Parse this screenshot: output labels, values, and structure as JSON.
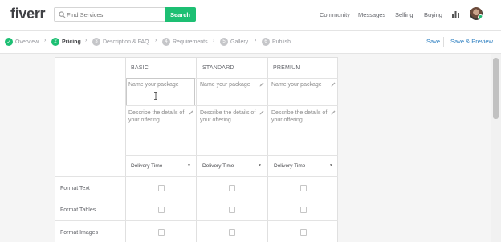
{
  "header": {
    "logo": "fiverr",
    "search_placeholder": "Find Services",
    "search_button": "Search",
    "nav": [
      "Community",
      "Messages",
      "Selling",
      "Buying"
    ]
  },
  "steps": [
    {
      "num": "✓",
      "label": "Overview",
      "state": "done"
    },
    {
      "num": "2",
      "label": "Pricing",
      "state": "active"
    },
    {
      "num": "3",
      "label": "Description & FAQ",
      "state": "pending"
    },
    {
      "num": "4",
      "label": "Requirements",
      "state": "pending"
    },
    {
      "num": "5",
      "label": "Gallery",
      "state": "pending"
    },
    {
      "num": "6",
      "label": "Publish",
      "state": "pending"
    }
  ],
  "actions": {
    "save": "Save",
    "save_preview": "Save & Preview"
  },
  "packages": {
    "columns": [
      "BASIC",
      "STANDARD",
      "PREMIUM"
    ],
    "name_placeholder": "Name your package",
    "description_placeholder": "Describe the details of your offering",
    "delivery_label": "Delivery Time",
    "features": [
      "Format Text",
      "Format Tables",
      "Format Images"
    ]
  },
  "colors": {
    "accent": "#1dbf73",
    "link": "#2d7fc1"
  },
  "icons": {
    "search": "search-icon",
    "stats": "bar-chart-icon",
    "edit": "pencil-icon",
    "dropdown": "caret-down-icon"
  }
}
